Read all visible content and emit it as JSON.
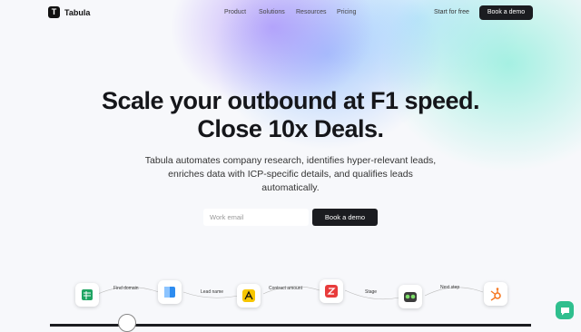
{
  "nav": {
    "brand": "Tabula",
    "menu": [
      "Product",
      "Solutions",
      "Resources",
      "Pricing"
    ],
    "start_label": "Start for free",
    "demo_label": "Book a demo"
  },
  "hero": {
    "title_line1": "Scale your outbound at F1 speed.",
    "title_line2": "Close 10x Deals.",
    "subtitle_line1": "Tabula automates company research, identifies hyper-relevant leads,",
    "subtitle_line2": "enriches data with ICP-specific details, and qualifies leads",
    "subtitle_line3": "automatically.",
    "email_placeholder": "Work email",
    "demo_label": "Book a demo"
  },
  "flow": {
    "steps": [
      "Find domain",
      "Lead name",
      "Contract amount",
      "Stage",
      "Next step"
    ],
    "apps": [
      "sheets-icon",
      "blue-app-icon",
      "yellow-arrow-icon",
      "red-z-icon",
      "green-robot-icon",
      "hubspot-icon"
    ]
  },
  "colors": {
    "dark_button": "#1b1c20",
    "accent_green": "#2fbf8e"
  }
}
